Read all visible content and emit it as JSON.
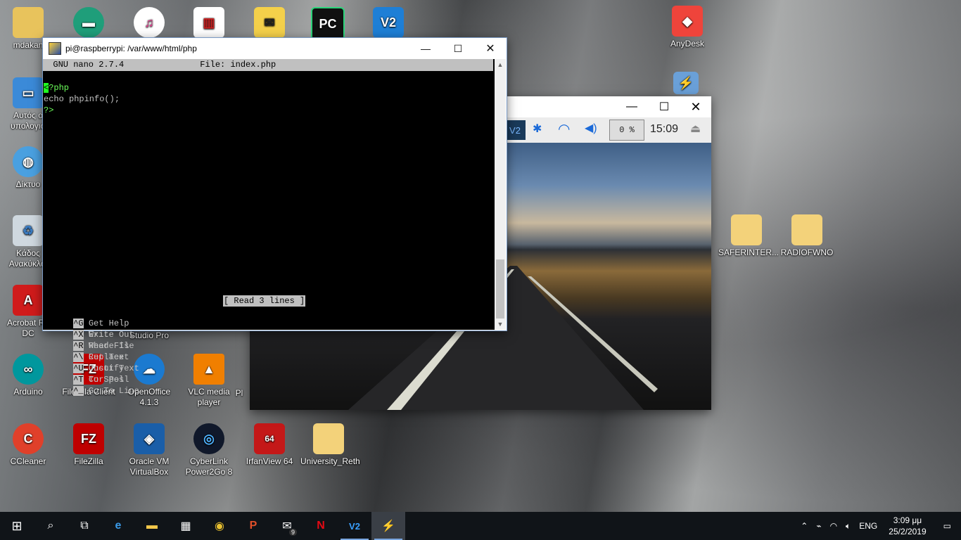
{
  "desktop_icons": [
    {
      "label": "mdakan",
      "id": "user-folder"
    },
    {
      "label": "",
      "id": "app-green"
    },
    {
      "label": "",
      "id": "itunes"
    },
    {
      "label": "",
      "id": "popcorn"
    },
    {
      "label": "",
      "id": "mail-app"
    },
    {
      "label": "",
      "id": "pycharm"
    },
    {
      "label": "",
      "id": "vnc"
    },
    {
      "label": "Αυτός ο υπολογισ",
      "id": "this-pc"
    },
    {
      "label": "Δίκτυο",
      "id": "network"
    },
    {
      "label": "Κάδος Ανακύκλω",
      "id": "recycle-bin"
    },
    {
      "label": "Acrobat Re DC",
      "id": "acrobat"
    },
    {
      "label": "Studio Pro",
      "id": "studio-pro"
    },
    {
      "label": "Arduino",
      "id": "arduino"
    },
    {
      "label": "FileZilla Client",
      "id": "filezilla-client"
    },
    {
      "label": "OpenOffice 4.1.3",
      "id": "openoffice"
    },
    {
      "label": "VLC media player",
      "id": "vlc"
    },
    {
      "label": "Pl",
      "id": "pl"
    },
    {
      "label": "CCleaner",
      "id": "ccleaner"
    },
    {
      "label": "FileZilla",
      "id": "filezilla"
    },
    {
      "label": "Oracle VM VirtualBox",
      "id": "virtualbox"
    },
    {
      "label": "CyberLink Power2Go 8",
      "id": "power2go"
    },
    {
      "label": "IrfanView 64",
      "id": "irfanview"
    },
    {
      "label": "University_Reth",
      "id": "university-folder"
    },
    {
      "label": "AnyDesk",
      "id": "anydesk"
    },
    {
      "label": "SAFERINTER...",
      "id": "saferinter-folder"
    },
    {
      "label": "RADIOFWNO",
      "id": "radiofwno-folder"
    }
  ],
  "putty": {
    "title": "pi@raspberrypi: /var/www/html/php",
    "nano_header": "  GNU nano 2.7.4               File: index.php",
    "lines": [
      "?php",
      "echo phpinfo();",
      "?>"
    ],
    "cursor_char": "<",
    "status": "[ Read 3 lines ]",
    "shortcuts_row1": [
      {
        "key": "^G",
        "label": " Get Help  "
      },
      {
        "key": "^O",
        "label": " Write Out "
      },
      {
        "key": "^W",
        "label": " Where Is  "
      },
      {
        "key": "^K",
        "label": " Cut Text  "
      },
      {
        "key": "^J",
        "label": " Justify   "
      },
      {
        "key": "^C",
        "label": " Cur Pos"
      }
    ],
    "shortcuts_row2": [
      {
        "key": "^X",
        "label": " Exit      "
      },
      {
        "key": "^R",
        "label": " Read File "
      },
      {
        "key": "^\\",
        "label": " Replace   "
      },
      {
        "key": "^U",
        "label": " Uncut Text"
      },
      {
        "key": "^T",
        "label": " To Spell  "
      },
      {
        "key": "^_",
        "label": " Go To Line"
      }
    ]
  },
  "vnc": {
    "cpu": "0 %",
    "time": "15:09"
  },
  "taskbar": {
    "badge_mail": "9",
    "lang": "ENG",
    "time": "3:09 μμ",
    "date": "25/2/2019"
  }
}
